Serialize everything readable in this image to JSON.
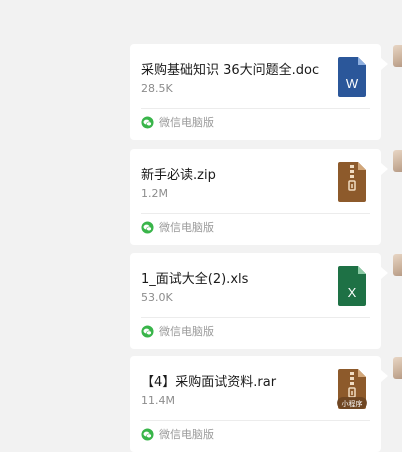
{
  "messages": [
    {
      "file_name": "采购基础知识 36大问题全.doc",
      "file_size": "28.5K",
      "source": "微信电脑版",
      "file_type_icon": "word-doc-icon",
      "icon_color": "#2b579a",
      "icon_letter": "W"
    },
    {
      "file_name": "新手必读.zip",
      "file_size": "1.2M",
      "source": "微信电脑版",
      "file_type_icon": "zip-archive-icon",
      "icon_color": "#8d5a2b",
      "icon_letter": ""
    },
    {
      "file_name": "1_面试大全(2).xls",
      "file_size": "53.0K",
      "source": "微信电脑版",
      "file_type_icon": "excel-xls-icon",
      "icon_color": "#1e7145",
      "icon_letter": "X"
    },
    {
      "file_name": "【4】采购面试资料.rar",
      "file_size": "11.4M",
      "source": "微信电脑版",
      "file_type_icon": "rar-archive-icon",
      "icon_color": "#8d5a2b",
      "icon_letter": "",
      "badge": "小程序"
    }
  ],
  "colors": {
    "background": "#f2f2f2",
    "bubble": "#ffffff",
    "wechat_green": "#39b54a"
  }
}
